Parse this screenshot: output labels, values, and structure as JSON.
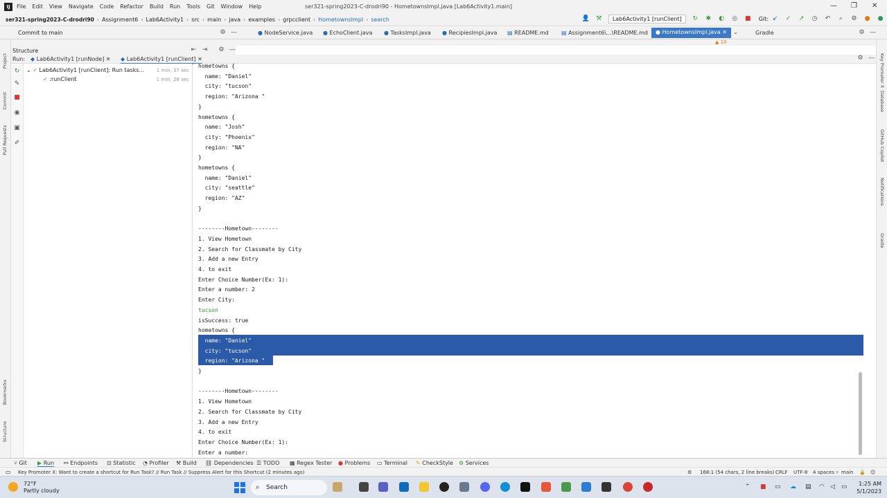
{
  "menubar": {
    "items": [
      "File",
      "Edit",
      "View",
      "Navigate",
      "Code",
      "Refactor",
      "Build",
      "Run",
      "Tools",
      "Git",
      "Window",
      "Help"
    ],
    "title": "ser321-spring2023-C-drodri90 - HometownsImpl.java [Lab6Activity1.main]"
  },
  "navbar": {
    "crumbs": [
      "ser321-spring2023-C-drodri90",
      "Assignment6",
      "Lab6Activity1",
      "src",
      "main",
      "java",
      "examples",
      "grpcclient",
      "HometownsImpl",
      "search"
    ],
    "run_config": "Lab6Activity1 [runClient]",
    "git": "Git:"
  },
  "tabs": {
    "commit": "Commit to main",
    "items": [
      "NodeService.java",
      "EchoClient.java",
      "TasksImpl.java",
      "RecipiesImpl.java",
      "README.md",
      "Assignment6\\...\\README.md",
      "HometownsImpl.java"
    ],
    "gradle": "Gradle",
    "warnings": "10"
  },
  "left_strip": [
    "Project",
    "Commit",
    "Pull Requests",
    "Bookmarks",
    "Structure"
  ],
  "right_strip": [
    "Key Promoter X",
    "Database",
    "Notifications",
    "Gradle",
    "GitHub Copilot"
  ],
  "structure_label": "Structure",
  "run_tabs": {
    "run": "Run:",
    "tab1": "Lab6Activity1 [runNode]",
    "tab2": "Lab6Activity1 [runClient]"
  },
  "tree": {
    "root": "Lab6Activity1 [runClient]: Run tasks...",
    "root_time": "1 min, 37 sec",
    "child": ":runClient",
    "child_time": "1 min, 28 sec"
  },
  "console_lines": [
    {
      "text": "hometowns {"
    },
    {
      "text": "  name: \"Daniel\""
    },
    {
      "text": "  city: \"tucson\""
    },
    {
      "text": "  region: \"Arizona \""
    },
    {
      "text": "}"
    },
    {
      "text": "hometowns {"
    },
    {
      "text": "  name: \"Josh\""
    },
    {
      "text": "  city: \"Phoenix\""
    },
    {
      "text": "  region: \"NA\""
    },
    {
      "text": "}"
    },
    {
      "text": "hometowns {"
    },
    {
      "text": "  name: \"Daniel\""
    },
    {
      "text": "  city: \"seattle\""
    },
    {
      "text": "  region: \"AZ\""
    },
    {
      "text": "}"
    },
    {
      "text": ""
    },
    {
      "text": "--------Hometown--------"
    },
    {
      "text": "1. View Hometown"
    },
    {
      "text": "2. Search for Classmate by City"
    },
    {
      "text": "3. Add a new Entry"
    },
    {
      "text": "4. to exit"
    },
    {
      "text": "Enter Choice Number(Ex: 1):"
    },
    {
      "text": "Enter a number: 2"
    },
    {
      "text": "Enter City:"
    },
    {
      "text": "tucson"
    },
    {
      "text": "isSuccess: true"
    },
    {
      "text": "hometowns {"
    },
    {
      "text": "  name: \"Daniel\""
    },
    {
      "text": "  city: \"tucson\""
    },
    {
      "text": "  region: \"Arizona \""
    },
    {
      "text": "}"
    },
    {
      "text": ""
    },
    {
      "text": "--------Hometown--------"
    },
    {
      "text": "1. View Hometown"
    },
    {
      "text": "2. Search for Classmate by City"
    },
    {
      "text": "3. Add a new Entry"
    },
    {
      "text": "4. to exit"
    },
    {
      "text": "Enter Choice Number(Ex: 1):"
    },
    {
      "text": "Enter a number:"
    }
  ],
  "tool_windows": [
    "Git",
    "Run",
    "Endpoints",
    "Statistic",
    "Profiler",
    "Build",
    "Dependencies",
    "TODO",
    "Regex Tester",
    "Problems",
    "Terminal",
    "CheckStyle",
    "Services"
  ],
  "status": {
    "message": "Key Promoter X: Want to create a shortcut for Run Task? // Run Task // Suppress Alert for this Shortcut (2 minutes ago)",
    "position": "168:1 (54 chars, 2 line breaks)",
    "line_sep": "CRLF",
    "encoding": "UTF-8",
    "indent": "4 spaces",
    "branch": "main"
  },
  "taskbar": {
    "temp": "72°F",
    "weather": "Partly cloudy",
    "search": "Search",
    "time": "1:25 AM",
    "date": "5/1/2023"
  }
}
